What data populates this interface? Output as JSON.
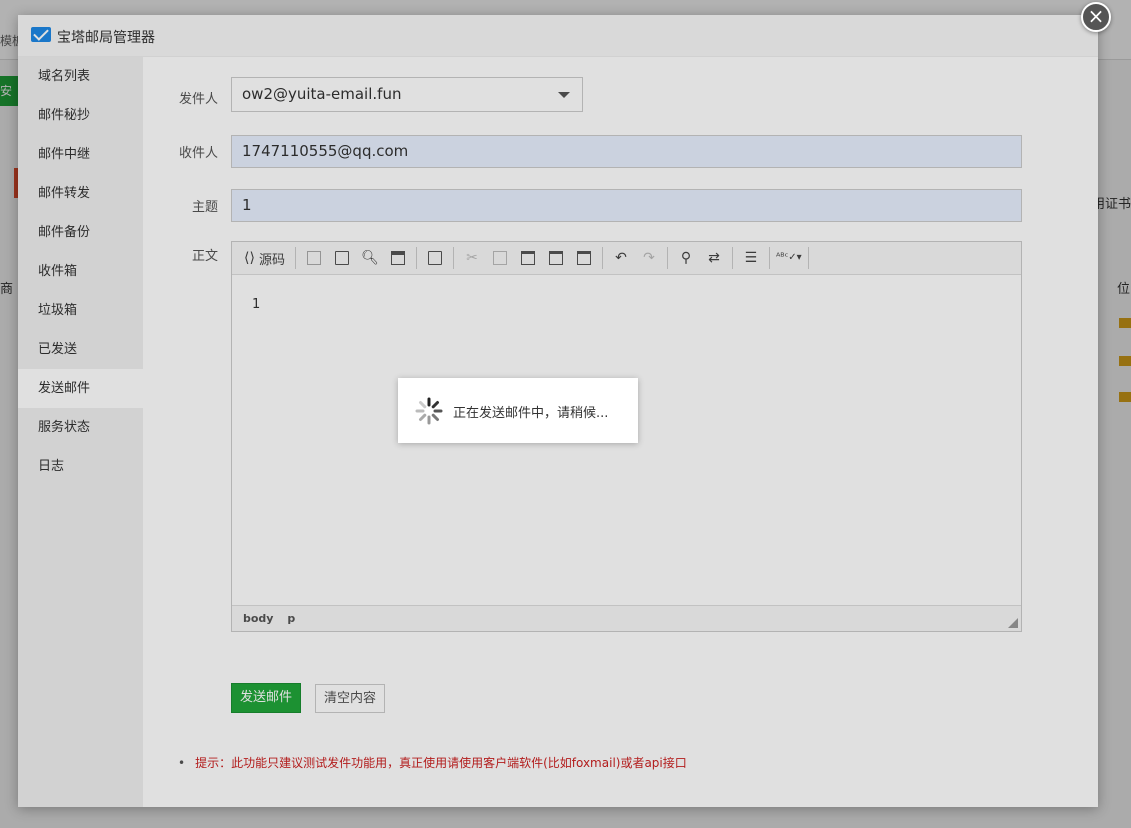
{
  "background": {
    "green_button": "安装",
    "top_left_text": "模板",
    "right_text": "用证书",
    "right_col_header": "位",
    "left_col_header": "商"
  },
  "modal": {
    "title": "宝塔邮局管理器",
    "close_label": "×"
  },
  "sidebar": {
    "items": [
      {
        "label": "域名列表"
      },
      {
        "label": "邮件秘抄"
      },
      {
        "label": "邮件中继"
      },
      {
        "label": "邮件转发"
      },
      {
        "label": "邮件备份"
      },
      {
        "label": "收件箱"
      },
      {
        "label": "垃圾箱"
      },
      {
        "label": "已发送"
      },
      {
        "label": "发送邮件"
      },
      {
        "label": "服务状态"
      },
      {
        "label": "日志"
      }
    ],
    "active_index": 8
  },
  "form": {
    "sender_label": "发件人",
    "sender_value": "ow2@yuita-email.fun",
    "recipient_label": "收件人",
    "recipient_value": "1747110555@qq.com",
    "subject_label": "主题",
    "subject_value": "1",
    "body_label": "正文"
  },
  "editor": {
    "source_label": "源码",
    "content": "1",
    "status_path": [
      "body",
      "p"
    ]
  },
  "buttons": {
    "send": "发送邮件",
    "clear": "清空内容"
  },
  "tip": "提示：此功能只建议测试发件功能用，真正使用请使用客户端软件(比如foxmail)或者api接口",
  "loading": {
    "text": "正在发送邮件中，请稍候..."
  },
  "colors": {
    "accent_green": "#20a53a",
    "tip_red": "#cc2222"
  }
}
